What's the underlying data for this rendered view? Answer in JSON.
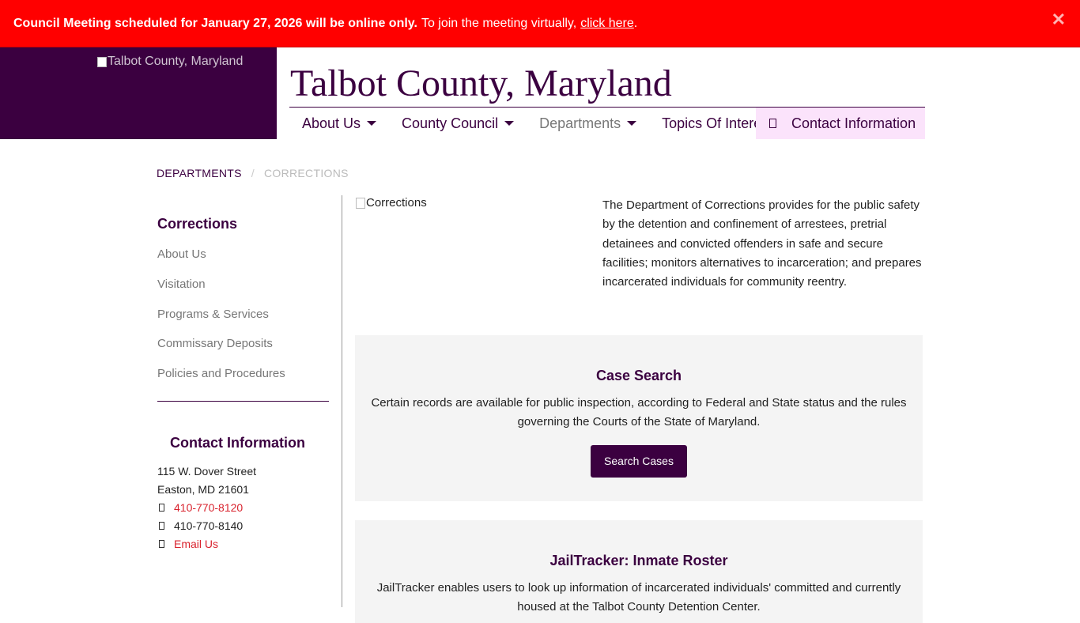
{
  "alert": {
    "bold": "Council Meeting scheduled for January 27, 2026 will be online only.",
    "text": "To join the meeting virtually,",
    "link": "click here",
    "period": ".",
    "close": "✕"
  },
  "header": {
    "logo_alt": "Talbot County, Maryland",
    "site_title": "Talbot County, Maryland"
  },
  "nav": {
    "items": [
      {
        "label": "About Us"
      },
      {
        "label": "County Council"
      },
      {
        "label": "Departments"
      },
      {
        "label": "Topics Of Interest"
      }
    ],
    "contact": "Contact Information"
  },
  "breadcrumb": {
    "parent": "DEPARTMENTS",
    "separator": "/",
    "current": "CORRECTIONS"
  },
  "sidebar": {
    "title": "Corrections",
    "links": [
      "About Us",
      "Visitation",
      "Programs & Services",
      "Commissary Deposits",
      "Policies and Procedures"
    ],
    "contact_title": "Contact Information",
    "address1": "115 W. Dover Street",
    "address2": "Easton, MD 21601",
    "phone": "410-770-8120",
    "fax": "410-770-8140",
    "email": "Email Us"
  },
  "main": {
    "image_alt": "Corrections",
    "intro": "The Department of Corrections provides for the public safety by the detention and confinement of arrestees, pretrial detainees and convicted offenders in safe and secure facilities; monitors alternatives to incarceration; and prepares incarcerated individuals for community reentry.",
    "cards": [
      {
        "title": "Case Search",
        "text": "Certain records are available for public inspection, according to Federal and State status and the rules governing the Courts of the State of Maryland.",
        "button": "Search Cases"
      },
      {
        "title": "JailTracker: Inmate Roster",
        "text": "JailTracker enables users to look up information of incarcerated individuals' committed and currently housed at the Talbot County Detention Center."
      }
    ]
  },
  "colors": {
    "brand": "#3b0040",
    "alert": "#ff0000",
    "link_red": "#d9232e",
    "card_bg": "#f4f4f4",
    "contact_nav_bg": "#fbe3fb"
  }
}
